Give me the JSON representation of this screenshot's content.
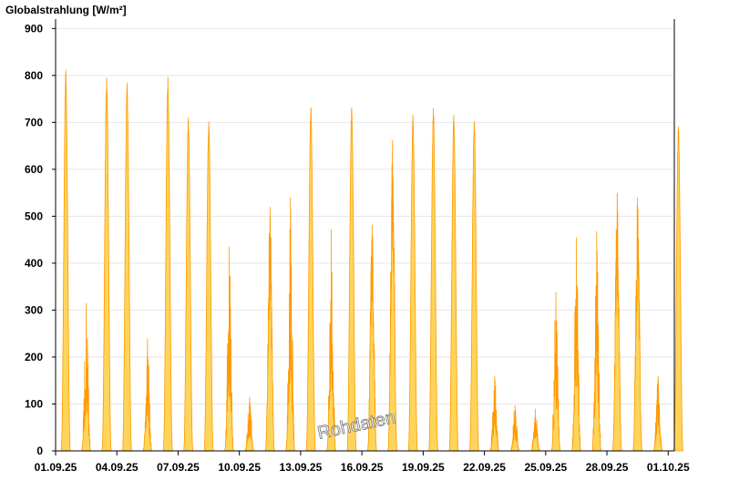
{
  "chart_data": {
    "type": "area",
    "title": "Globalstrahlung [W/m²]",
    "xlabel": "",
    "ylabel": "",
    "ylim": [
      0,
      920
    ],
    "yticks": [
      0,
      100,
      200,
      300,
      400,
      500,
      600,
      700,
      800,
      900
    ],
    "xlim_days": [
      0,
      30.3
    ],
    "xticks": [
      "01.09.25",
      "04.09.25",
      "07.09.25",
      "10.09.25",
      "13.09.25",
      "16.09.25",
      "19.09.25",
      "22.09.25",
      "25.09.25",
      "28.09.25",
      "01.10.25"
    ],
    "xtick_step_days": 3,
    "grid": true,
    "legend": "none",
    "fill_color": "#ffd45a",
    "line_color": "#ff9900",
    "watermark": "Rohdaten",
    "daily_peaks": [
      {
        "date": "01.09.25",
        "peak": 812,
        "shape": "clear"
      },
      {
        "date": "02.09.25",
        "peak": 315,
        "shape": "cloudy"
      },
      {
        "date": "03.09.25",
        "peak": 795,
        "shape": "clear"
      },
      {
        "date": "04.09.25",
        "peak": 785,
        "shape": "clear"
      },
      {
        "date": "05.09.25",
        "peak": 240,
        "shape": "cloudy"
      },
      {
        "date": "06.09.25",
        "peak": 797,
        "shape": "clear"
      },
      {
        "date": "07.09.25",
        "peak": 710,
        "shape": "clear"
      },
      {
        "date": "08.09.25",
        "peak": 702,
        "shape": "clear"
      },
      {
        "date": "09.09.25",
        "peak": 435,
        "shape": "cloudy"
      },
      {
        "date": "10.09.25",
        "peak": 115,
        "shape": "cloudy"
      },
      {
        "date": "11.09.25",
        "peak": 520,
        "shape": "mixed"
      },
      {
        "date": "12.09.25",
        "peak": 540,
        "shape": "cloudy"
      },
      {
        "date": "13.09.25",
        "peak": 732,
        "shape": "clear"
      },
      {
        "date": "14.09.25",
        "peak": 472,
        "shape": "cloudy"
      },
      {
        "date": "15.09.25",
        "peak": 732,
        "shape": "clear"
      },
      {
        "date": "16.09.25",
        "peak": 482,
        "shape": "mixed"
      },
      {
        "date": "17.09.25",
        "peak": 662,
        "shape": "mixed"
      },
      {
        "date": "18.09.25",
        "peak": 716,
        "shape": "clear"
      },
      {
        "date": "19.09.25",
        "peak": 730,
        "shape": "clear"
      },
      {
        "date": "20.09.25",
        "peak": 716,
        "shape": "clear"
      },
      {
        "date": "21.09.25",
        "peak": 702,
        "shape": "clear"
      },
      {
        "date": "22.09.25",
        "peak": 160,
        "shape": "cloudy"
      },
      {
        "date": "23.09.25",
        "peak": 97,
        "shape": "cloudy"
      },
      {
        "date": "24.09.25",
        "peak": 90,
        "shape": "cloudy"
      },
      {
        "date": "25.09.25",
        "peak": 338,
        "shape": "cloudy"
      },
      {
        "date": "26.09.25",
        "peak": 455,
        "shape": "cloudy"
      },
      {
        "date": "27.09.25",
        "peak": 468,
        "shape": "cloudy"
      },
      {
        "date": "28.09.25",
        "peak": 550,
        "shape": "mixed"
      },
      {
        "date": "29.09.25",
        "peak": 540,
        "shape": "mixed"
      },
      {
        "date": "30.09.25",
        "peak": 160,
        "shape": "cloudy"
      },
      {
        "date": "01.10.25",
        "peak": 692,
        "shape": "clear"
      }
    ]
  }
}
